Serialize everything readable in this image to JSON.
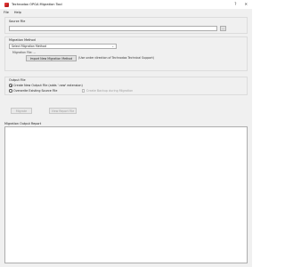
{
  "window": {
    "title": "Technodox OPGA Migration Tool",
    "help_glyph": "?",
    "close_glyph": "✕"
  },
  "menu": [
    "File",
    "Help"
  ],
  "source_file": {
    "label": "Source File",
    "value": "",
    "browse_label": "..."
  },
  "migration_method": {
    "label": "Migration Method",
    "selected": "Select Migration Method",
    "migration_file_text": "Migration File: --",
    "import_button": "Import New Migration Method",
    "hint": "(Use under direction of Technodox Technical Support)"
  },
  "output_file": {
    "label": "Output File",
    "option_create": "Create New Output File (adds '.new' extension)",
    "option_overwrite": "Overwrite Existing Source File",
    "backup_label": "Create Backup during Migration"
  },
  "actions": {
    "migrate": "Migrate",
    "view_report": "View Report File"
  },
  "report": {
    "label": "Migration Output Report",
    "content": ""
  }
}
